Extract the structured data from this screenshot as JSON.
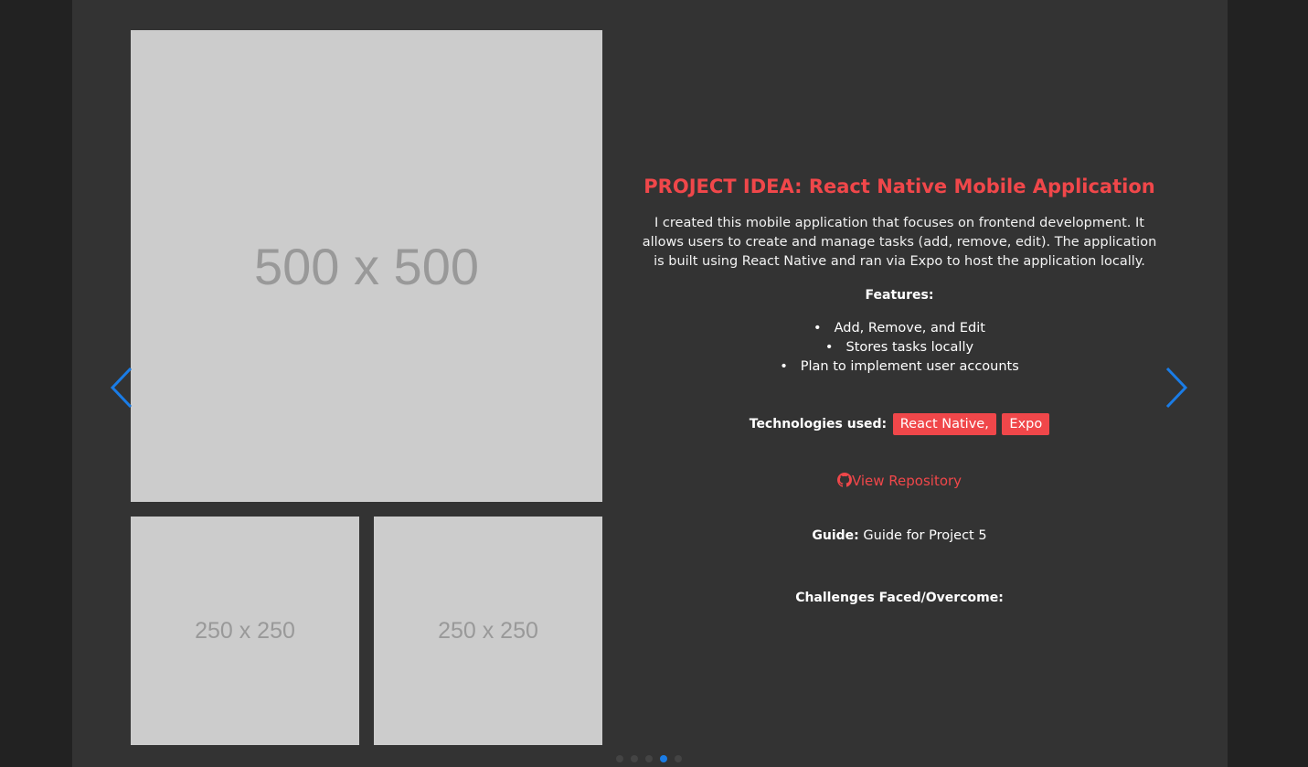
{
  "images": {
    "main_label": "500 x 500",
    "thumb1_label": "250 x 250",
    "thumb2_label": "250 x 250"
  },
  "project": {
    "title": "PROJECT IDEA: React Native Mobile Application",
    "description": "I created this mobile application that focuses on frontend development. It allows users to create and manage tasks (add, remove, edit). The application is built using React Native and ran via Expo to host the application locally.",
    "features_heading": "Features:",
    "features": [
      "Add, Remove, and Edit",
      "Stores tasks locally",
      "Plan to implement user accounts"
    ],
    "technologies_label": "Technologies used:",
    "technologies": [
      "React Native,",
      "Expo"
    ],
    "repo_link_text": "View Repository",
    "guide_label": "Guide:",
    "guide_value": "Guide for Project 5",
    "challenges_heading": "Challenges Faced/Overcome:"
  },
  "carousel": {
    "slide_count": 5,
    "active_index": 3
  },
  "colors": {
    "background": "#222222",
    "panel": "#333333",
    "accent": "#f0474a",
    "arrow": "#1a7ce6",
    "placeholder": "#cccccc"
  },
  "icons": {
    "prev": "chevron-left-icon",
    "next": "chevron-right-icon",
    "repo": "github-icon"
  }
}
